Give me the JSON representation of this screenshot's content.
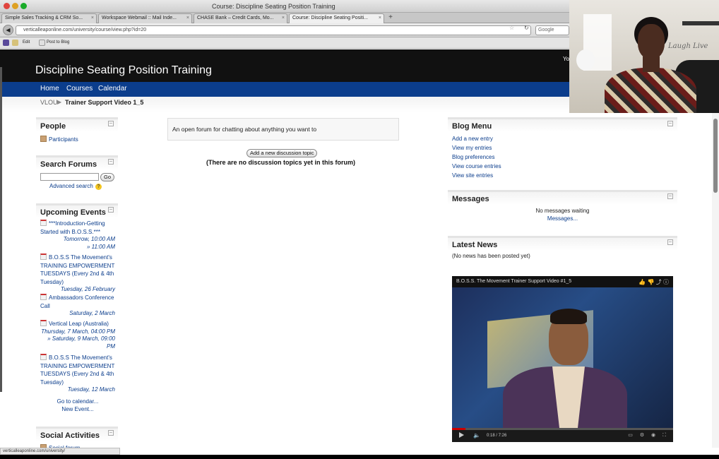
{
  "window": {
    "title": "Course: Discipline Seating Position Training"
  },
  "tabs": [
    {
      "label": "Simple Sales Tracking & CRM So..."
    },
    {
      "label": "Workspace Webmail :: Mail Inde..."
    },
    {
      "label": "CHASE Bank – Credit Cards, Mo..."
    },
    {
      "label": "Course: Discipline Seating Positi..."
    }
  ],
  "url": "verticalleaponline.com/university/course/view.php?id=20",
  "search_placeholder": "Google",
  "bookmarks": {
    "edit": "Edit",
    "post": "Post to Blog"
  },
  "site": {
    "title": "Discipline Seating Position Training",
    "user_partial": "Yo",
    "nav": [
      "Home",
      "Courses",
      "Calendar"
    ],
    "breadcrumb": {
      "link": "VLOU",
      "current": "Trainer Support Video 1_5"
    }
  },
  "people": {
    "title": "People",
    "participants": "Participants"
  },
  "search_forums": {
    "title": "Search Forums",
    "go": "Go",
    "advanced": "Advanced search"
  },
  "upcoming": {
    "title": "Upcoming Events",
    "events": [
      {
        "title": "***Introduction-Getting Started with B.O.S.S.***",
        "line1": "Tomorrow, 10:00 AM",
        "line2": "» 11:00 AM"
      },
      {
        "title": "B.O.S.S The Movement's TRAINING EMPOWERMENT TUESDAYS (Every 2nd & 4th Tuesday)",
        "line1": "Tuesday, 26 February",
        "line2": ""
      },
      {
        "title": "Ambassadors Conference Call",
        "line1": "Saturday, 2 March",
        "line2": ""
      },
      {
        "title": "Vertical Leap (Australia)",
        "line1": "Thursday, 7 March, 04:00 PM",
        "line2": "» Saturday, 9 March, 09:00 PM"
      },
      {
        "title": "B.O.S.S The Movement's TRAINING EMPOWERMENT TUESDAYS (Every 2nd & 4th Tuesday)",
        "line1": "Tuesday, 12 March",
        "line2": ""
      }
    ],
    "go_calendar": "Go to calendar...",
    "new_event": "New Event..."
  },
  "social": {
    "title": "Social Activities",
    "forum": "Social forum"
  },
  "forum": {
    "description": "An open forum for chatting about anything you want to",
    "add_button": "Add a new discussion topic",
    "no_topics": "(There are no discussion topics yet in this forum)"
  },
  "blog_menu": {
    "title": "Blog Menu",
    "links": [
      "Add a new entry",
      "View my entries",
      "Blog preferences",
      "View course entries",
      "View site entries"
    ]
  },
  "messages": {
    "title": "Messages",
    "none": "No messages waiting",
    "link": "Messages..."
  },
  "latest_news": {
    "title": "Latest News",
    "none": "(No news has been posted yet)"
  },
  "video": {
    "title": "B.O.S.S. The Movement Trainer Support Video #1_5",
    "time": "0:18 / 7:26",
    "progress": 0.06
  },
  "statusbar": "verticalleaponline.com/university/",
  "webcam_sign": "Laugh Live"
}
